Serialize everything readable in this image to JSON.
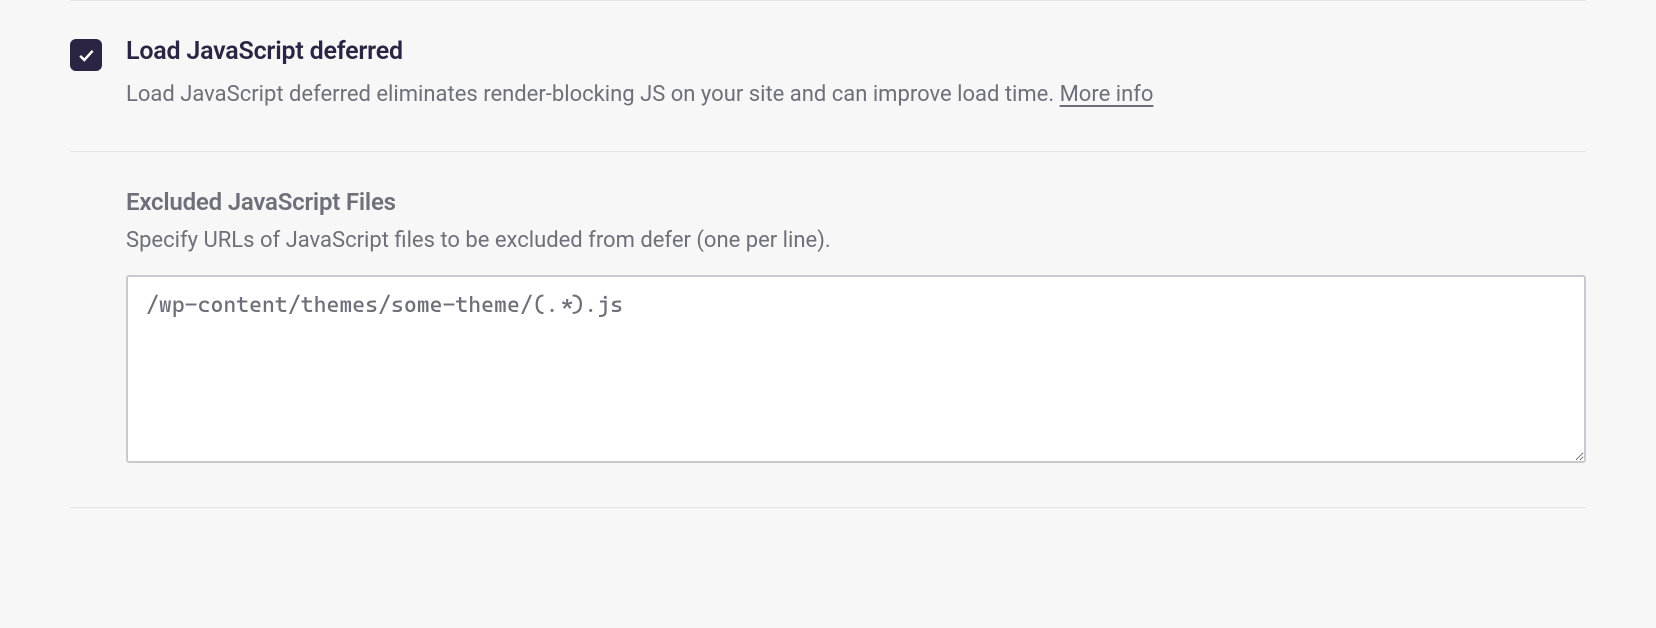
{
  "defer": {
    "title": "Load JavaScript deferred",
    "description": "Load JavaScript deferred eliminates render-blocking JS on your site and can improve load time. ",
    "more_info_label": "More info",
    "checked": true
  },
  "excluded": {
    "title": "Excluded JavaScript Files",
    "description": "Specify URLs of JavaScript files to be excluded from defer (one per line).",
    "value": "/wp-content/themes/some-theme/(.*).js"
  }
}
